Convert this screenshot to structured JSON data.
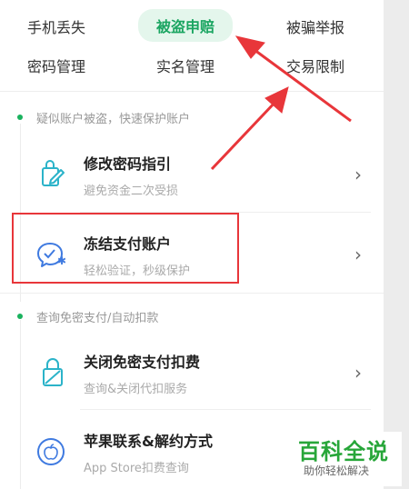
{
  "tabs_row1": [
    "手机丢失",
    "被盗申赔",
    "被骗举报"
  ],
  "tabs_row2": [
    "密码管理",
    "实名管理",
    "交易限制"
  ],
  "section1": {
    "title": "疑似账户被盗，快速保护账户",
    "items": [
      {
        "title": "修改密码指引",
        "subtitle": "避免资金二次受损",
        "icon": "edit-lock-icon"
      },
      {
        "title": "冻结支付账户",
        "subtitle": "轻松验证，秒级保护",
        "icon": "chat-freeze-icon"
      }
    ]
  },
  "section2": {
    "title": "查询免密支付/自动扣款",
    "items": [
      {
        "title": "关闭免密支付扣费",
        "subtitle": "查询&关闭代扣服务",
        "icon": "lock-slash-icon"
      },
      {
        "title": "苹果联系&解约方式",
        "subtitle": "App Store扣费查询",
        "icon": "apple-icon"
      }
    ]
  },
  "chevron": "›",
  "watermark": {
    "main": "百科全说",
    "sub": "助你轻松解决"
  },
  "colors": {
    "accent": "#1aa561",
    "annotation": "#e8363a",
    "icon": "#2bb3c9"
  }
}
